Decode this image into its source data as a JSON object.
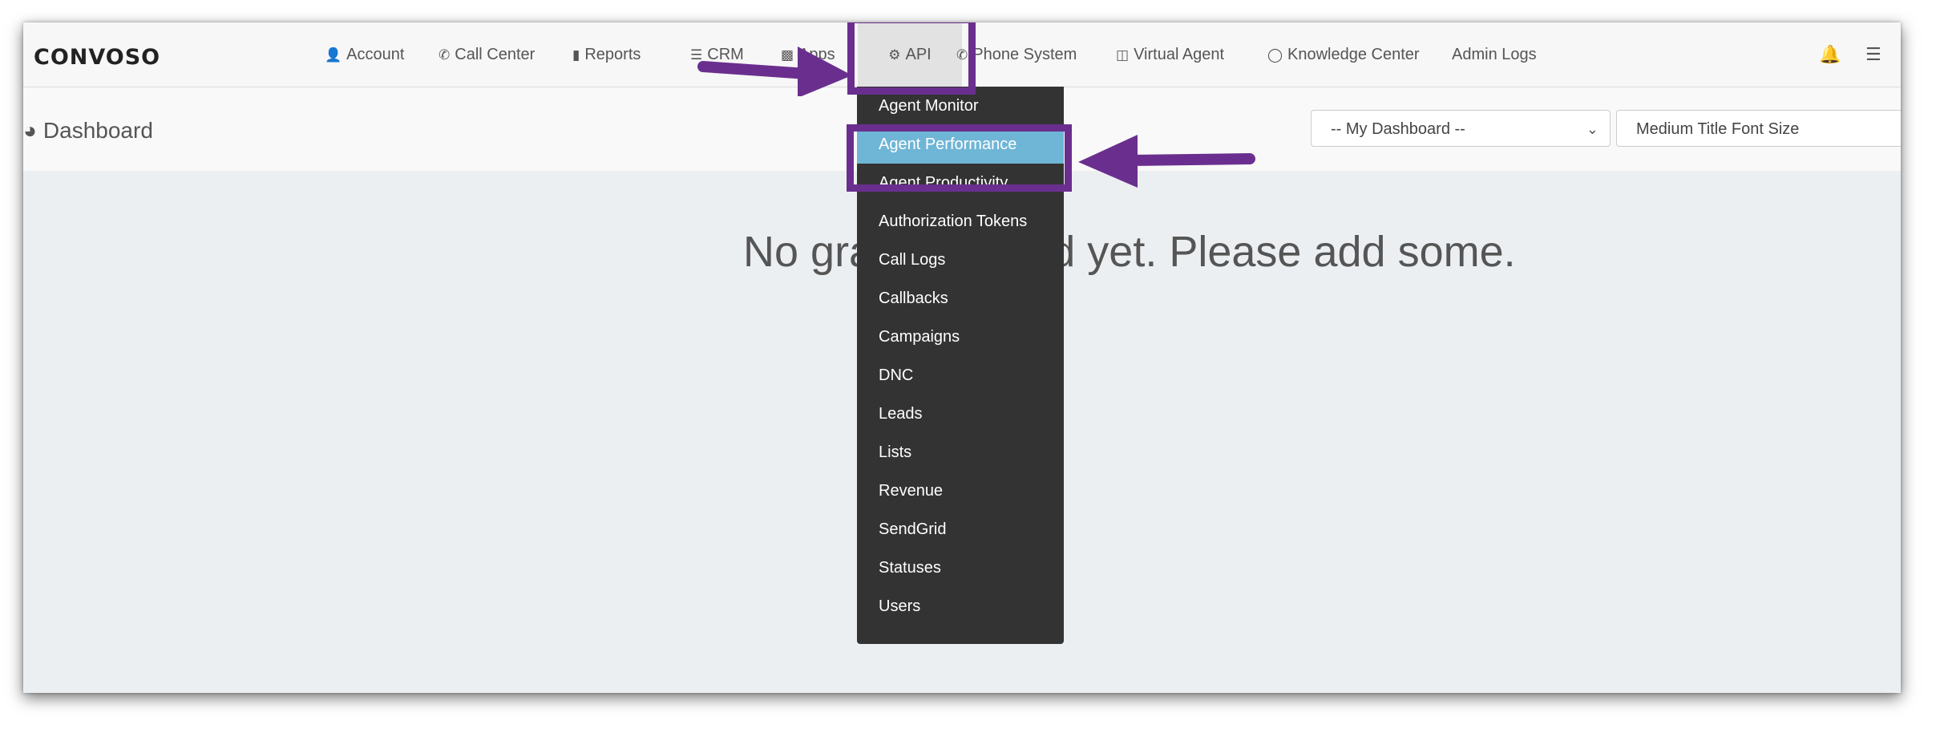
{
  "brand": {
    "logo_text": "CONVOSO"
  },
  "nav": {
    "items": [
      {
        "label": "Account",
        "icon": "user-icon"
      },
      {
        "label": "Call Center",
        "icon": "phone-icon"
      },
      {
        "label": "Reports",
        "icon": "bar-chart-icon"
      },
      {
        "label": "CRM",
        "icon": "list-icon"
      },
      {
        "label": "Apps",
        "icon": "grid-icon"
      },
      {
        "label": "API",
        "icon": "gear-icon"
      },
      {
        "label": "Phone System",
        "icon": "phone-icon"
      },
      {
        "label": "Virtual Agent",
        "icon": "monitor-icon"
      },
      {
        "label": "Knowledge Center",
        "icon": "lightbulb-icon"
      },
      {
        "label": "Admin Logs"
      }
    ],
    "right_icons": [
      "bell-icon",
      "database-icon"
    ]
  },
  "header": {
    "title": "Dashboard",
    "dashboard_select": "-- My Dashboard --",
    "font_size_select": "Medium Title Font Size"
  },
  "main": {
    "empty_message": "No graphs added yet. Please add some."
  },
  "api_menu": {
    "items": [
      "Agent Monitor",
      "Agent Performance",
      "Agent Productivity",
      "Authorization Tokens",
      "Call Logs",
      "Callbacks",
      "Campaigns",
      "DNC",
      "Leads",
      "Lists",
      "Revenue",
      "SendGrid",
      "Statuses",
      "Users"
    ],
    "highlighted": "Agent Performance"
  },
  "annotation_color": "#6a2f8e"
}
